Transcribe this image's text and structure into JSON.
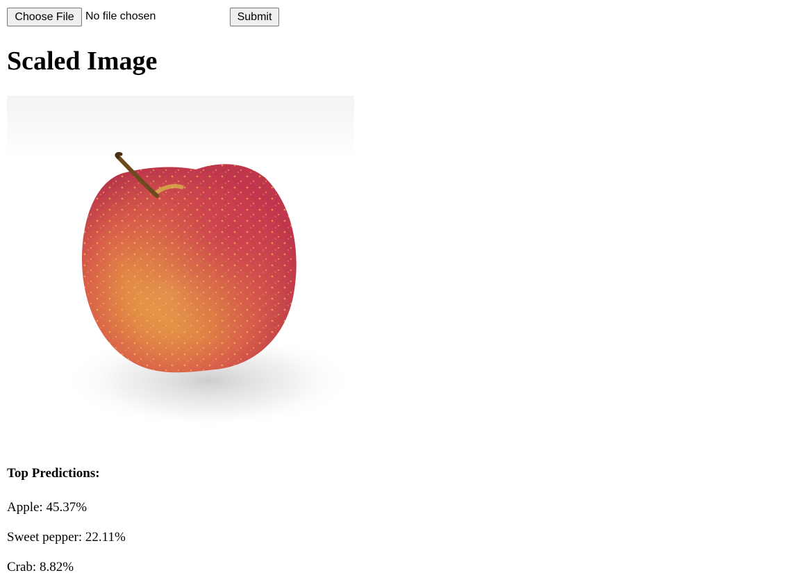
{
  "form": {
    "choose_file_label": "Choose File",
    "file_status": "No file chosen",
    "submit_label": "Submit"
  },
  "page_title": "Scaled Image",
  "image": {
    "subject": "apple",
    "background_color": "#ffffff"
  },
  "predictions": {
    "heading": "Top Predictions:",
    "items": [
      {
        "text": "Apple: 45.37%",
        "label": "Apple",
        "percent": 45.37
      },
      {
        "text": "Sweet pepper: 22.11%",
        "label": "Sweet pepper",
        "percent": 22.11
      },
      {
        "text": "Crab: 8.82%",
        "label": "Crab",
        "percent": 8.82
      }
    ]
  }
}
